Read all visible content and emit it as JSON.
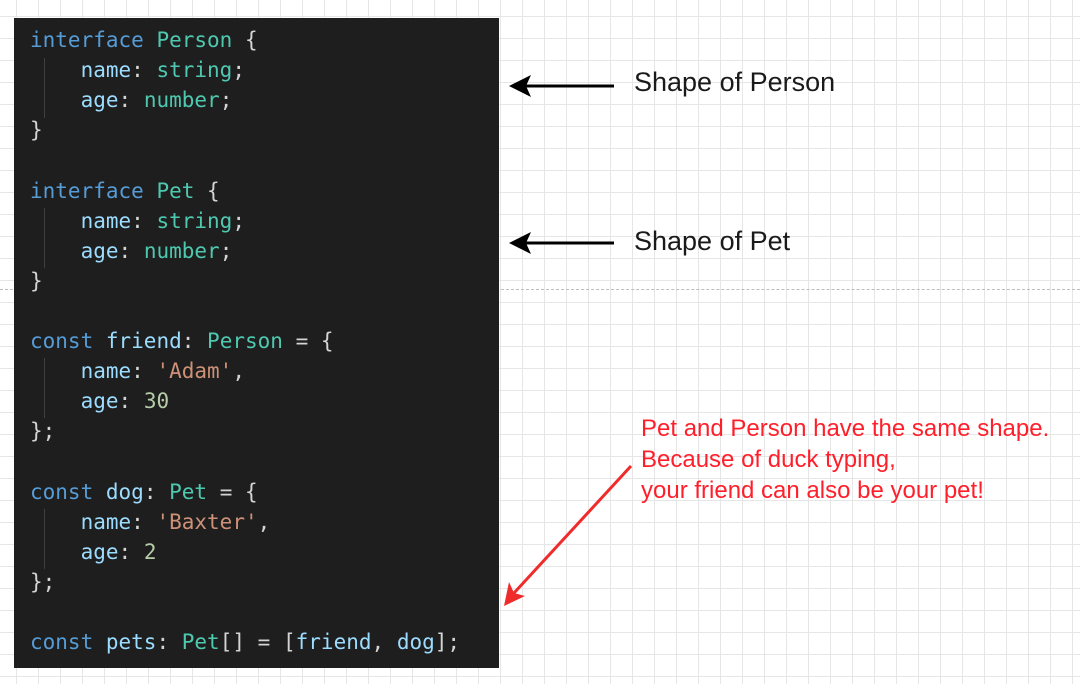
{
  "code_lines": [
    "interface Person {",
    "    name: string;",
    "    age: number;",
    "}",
    "",
    "interface Pet {",
    "    name: string;",
    "    age: number;",
    "}",
    "",
    "const friend: Person = {",
    "    name: 'Adam',",
    "    age: 30",
    "};",
    "",
    "const dog: Pet = {",
    "    name: 'Baxter',",
    "    age: 2",
    "};",
    "",
    "const pets: Pet[] = [friend, dog];"
  ],
  "labels": {
    "shape_person": "Shape of Person",
    "shape_pet": "Shape of Pet"
  },
  "annotation": {
    "line1": "Pet and Person have the same shape.",
    "line2": "Because of duck typing,",
    "line3": "your friend can also be your pet!"
  },
  "colors": {
    "code_background": "#1e1e1e",
    "keyword": "#569cd6",
    "type": "#4ec9b0",
    "property": "#9cdcfe",
    "string": "#ce9178",
    "number": "#b5cea8",
    "annotation_text": "#ff1f2a",
    "black_arrow": "#000000",
    "red_arrow": "#ef2b2b"
  },
  "icons": {
    "arrow_person": "left-arrow-icon",
    "arrow_pet": "left-arrow-icon",
    "arrow_annotation": "diagonal-red-arrow-icon"
  }
}
